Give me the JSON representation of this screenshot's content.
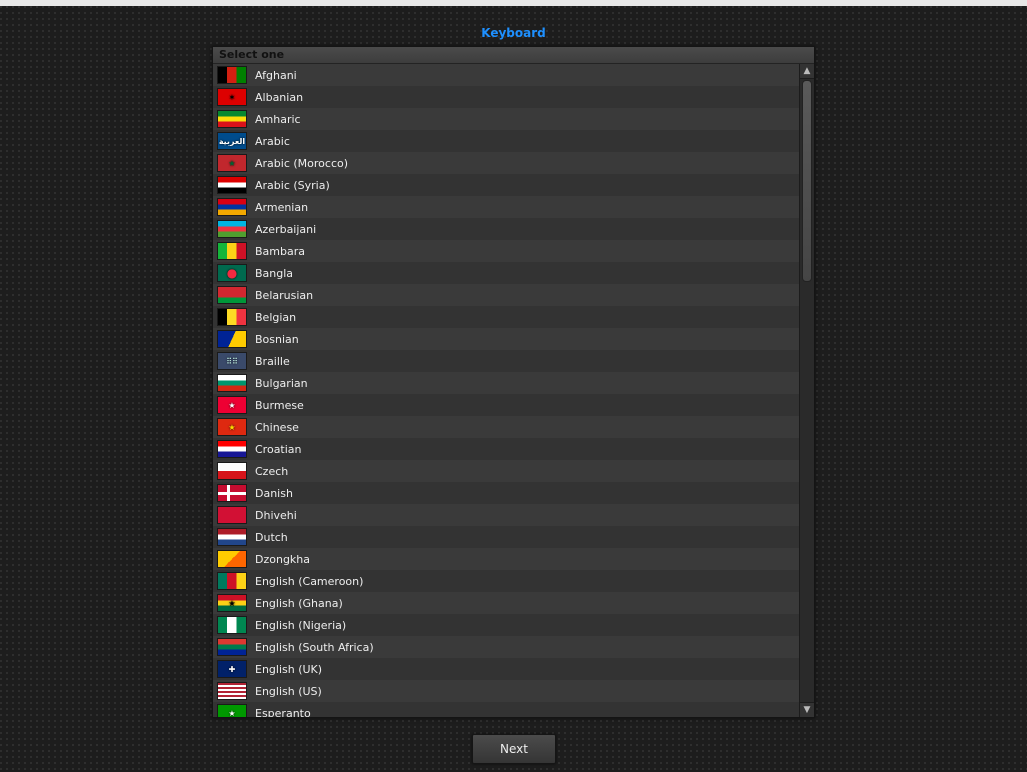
{
  "title": "Keyboard",
  "header": "Select one",
  "next_button": "Next",
  "items": [
    {
      "label": "Afghani",
      "flag_css": "background:linear-gradient(90deg,#000 33%,#d32011 33% 66%,#008000 66%)"
    },
    {
      "label": "Albanian",
      "flag_css": "background:#d00;color:#000",
      "glyph": "✶"
    },
    {
      "label": "Amharic",
      "flag_css": "background:linear-gradient(#078930 33%,#fcdd09 33% 66%,#da121a 66%)"
    },
    {
      "label": "Arabic",
      "flag_css": "background:#004c8c;color:#fff;font-weight:bold",
      "glyph": "العربية"
    },
    {
      "label": "Arabic (Morocco)",
      "flag_css": "background:#c1272d;color:#006233;font-weight:bold",
      "glyph": "★"
    },
    {
      "label": "Arabic (Syria)",
      "flag_css": "background:linear-gradient(#d00 33%,#fff 33% 66%,#000 66%)"
    },
    {
      "label": "Armenian",
      "flag_css": "background:linear-gradient(#d90012 33%,#0033a0 33% 66%,#f2a800 66%)"
    },
    {
      "label": "Azerbaijani",
      "flag_css": "background:linear-gradient(#00b5e2 33%,#ef3340 33% 66%,#509e2f 66%)"
    },
    {
      "label": "Bambara",
      "flag_css": "background:linear-gradient(90deg,#14b53a 33%,#fcd116 33% 66%,#ce1126 66%)"
    },
    {
      "label": "Bangla",
      "flag_css": "background:#006a4e;color:#f42a41;font-size:12px",
      "glyph": "●"
    },
    {
      "label": "Belarusian",
      "flag_css": "background:linear-gradient(#d22730 66%,#009739 66%)"
    },
    {
      "label": "Belgian",
      "flag_css": "background:linear-gradient(90deg,#000 33%,#fdda24 33% 66%,#ef3340 66%)"
    },
    {
      "label": "Bosnian",
      "flag_css": "background:linear-gradient(115deg,#002395 50%,#fecb00 50%)"
    },
    {
      "label": "Braille",
      "flag_css": "background:#3a4a6a;color:#cfe",
      "glyph": "⠿⠿"
    },
    {
      "label": "Bulgarian",
      "flag_css": "background:linear-gradient(#fff 33%,#00966e 33% 66%,#d62612 66%)"
    },
    {
      "label": "Burmese",
      "flag_css": "background:#e03;color:#fff",
      "glyph": "★"
    },
    {
      "label": "Chinese",
      "flag_css": "background:#de2910;color:#ffde00",
      "glyph": "★"
    },
    {
      "label": "Croatian",
      "flag_css": "background:linear-gradient(#ff0000 33%,#fff 33% 66%,#171796 66%)"
    },
    {
      "label": "Czech",
      "flag_css": "background:linear-gradient(#fff 50%,#d7141a 50%)"
    },
    {
      "label": "Danish",
      "flag_css": "background:#c60c30;background-image:linear-gradient(#fff,#fff),linear-gradient(#fff,#fff);background-size:100% 3px,3px 100%;background-position:0 7px,9px 0;background-repeat:no-repeat"
    },
    {
      "label": "Dhivehi",
      "flag_css": "background:#d21034",
      "glyph": ""
    },
    {
      "label": "Dutch",
      "flag_css": "background:linear-gradient(#ae1c28 33%,#fff 33% 66%,#21468b 66%)"
    },
    {
      "label": "Dzongkha",
      "flag_css": "background:linear-gradient(135deg,#ffcc00 50%,#ff6600 50%)"
    },
    {
      "label": "English (Cameroon)",
      "flag_css": "background:linear-gradient(90deg,#007a5e 33%,#ce1126 33% 66%,#fcd116 66%)"
    },
    {
      "label": "English (Ghana)",
      "flag_css": "background:linear-gradient(#ce1126 33%,#fcd116 33% 66%,#006b3f 66%);color:#000",
      "glyph": "★"
    },
    {
      "label": "English (Nigeria)",
      "flag_css": "background:linear-gradient(90deg,#008751 33%,#fff 33% 66%,#008751 66%)"
    },
    {
      "label": "English (South Africa)",
      "flag_css": "background:linear-gradient(#de3831 33%,#007a4d 33% 66%,#002395 66%)"
    },
    {
      "label": "English (UK)",
      "flag_css": "background:#012169;color:#fff",
      "glyph": "✚"
    },
    {
      "label": "English (US)",
      "flag_css": "background:repeating-linear-gradient(#b22234 0 2px,#fff 2px 4px)"
    },
    {
      "label": "Esperanto",
      "flag_css": "background:#009900;color:#fff",
      "glyph": "★"
    }
  ]
}
